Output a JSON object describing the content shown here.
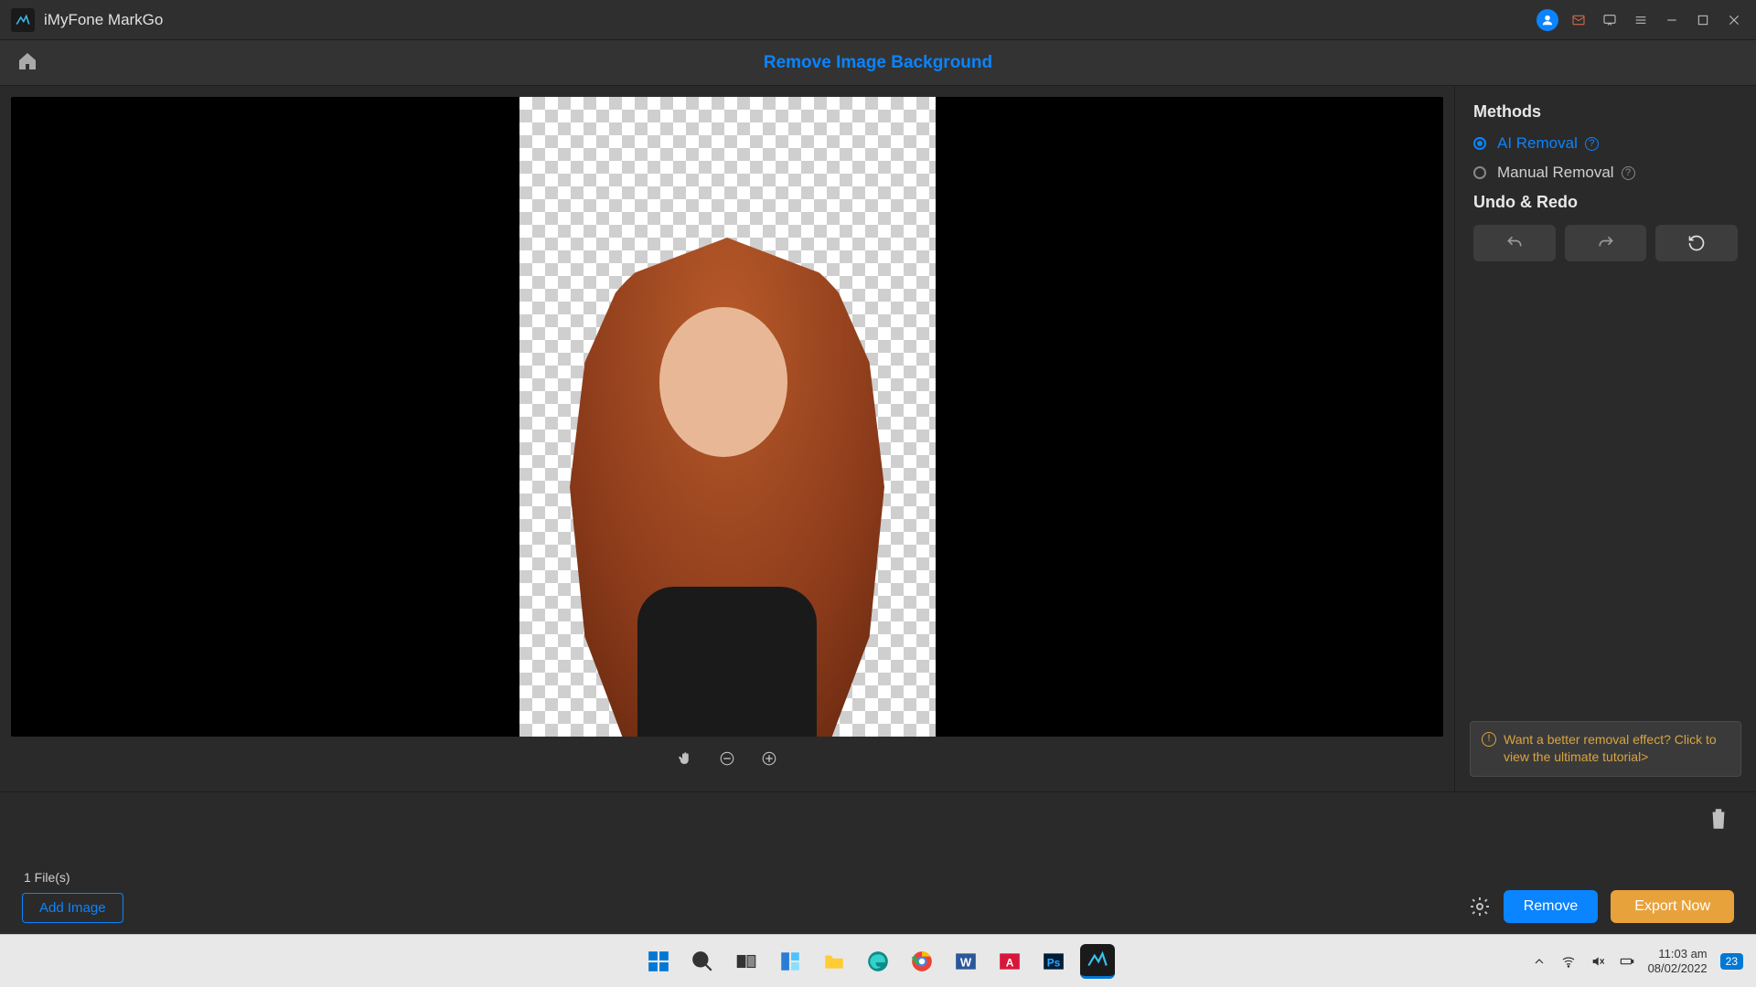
{
  "title_bar": {
    "app_name": "iMyFone MarkGo"
  },
  "subheader": {
    "mode_title": "Remove Image Background"
  },
  "sidebar": {
    "methods_heading": "Methods",
    "option_ai": "AI Removal",
    "option_manual": "Manual Removal",
    "undo_heading": "Undo & Redo",
    "tip_text": "Want a better removal effect? Click to view the ultimate tutorial>"
  },
  "thumb_strip": {
    "file_count": "1 File(s)",
    "add_image": "Add Image"
  },
  "actions": {
    "remove": "Remove",
    "export": "Export Now"
  },
  "taskbar": {
    "time": "11:03 am",
    "date": "08/02/2022",
    "notification_count": "23"
  }
}
